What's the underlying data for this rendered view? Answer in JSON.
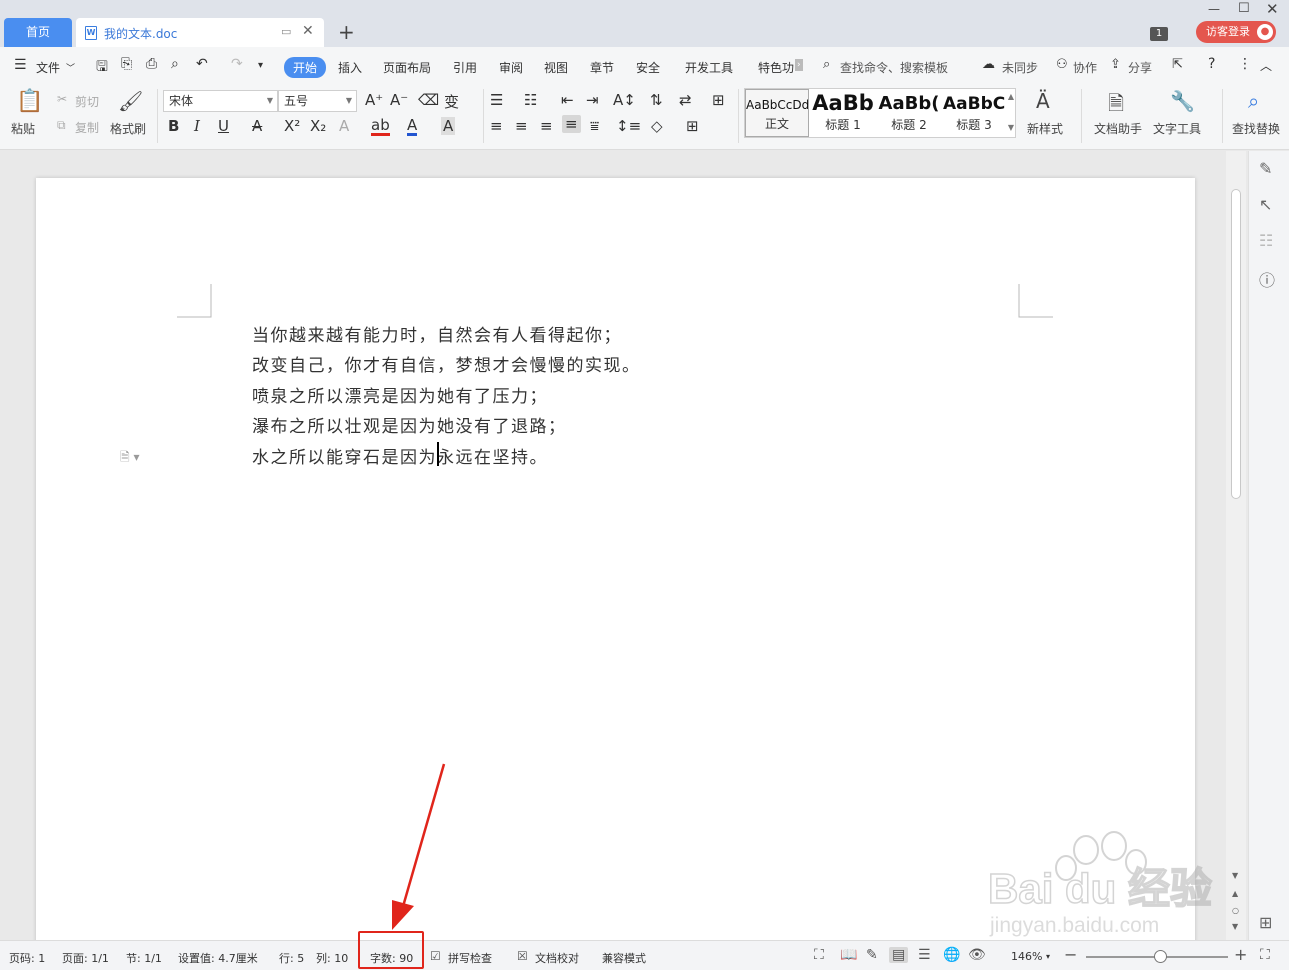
{
  "window": {
    "home_tab": "首页",
    "doc_tab": "我的文本.doc",
    "new_tab": "+",
    "tab_count": "1",
    "login": "访客登录"
  },
  "menu": {
    "file": "文件",
    "tabs": [
      "开始",
      "插入",
      "页面布局",
      "引用",
      "审阅",
      "视图",
      "章节",
      "安全",
      "开发工具",
      "特色功"
    ],
    "active_tab": "开始",
    "search": "查找命令、搜索模板",
    "sync": "未同步",
    "collab": "协作",
    "share": "分享"
  },
  "ribbon": {
    "paste": "粘贴",
    "cut": "剪切",
    "copy": "复制",
    "format_painter": "格式刷",
    "font_name": "宋体",
    "font_size": "五号",
    "styles": [
      {
        "preview": "AaBbCcDd",
        "name": "正文"
      },
      {
        "preview": "AaBb",
        "name": "标题 1"
      },
      {
        "preview": "AaBb(",
        "name": "标题 2"
      },
      {
        "preview": "AaBbC",
        "name": "标题 3"
      }
    ],
    "new_style": "新样式",
    "doc_assistant": "文档助手",
    "text_tools": "文字工具",
    "find_replace": "查找替换"
  },
  "document": {
    "lines": [
      "当你越来越有能力时，自然会有人看得起你；",
      "改变自己，你才有自信，梦想才会慢慢的实现。",
      "喷泉之所以漂亮是因为她有了压力；",
      "瀑布之所以壮观是因为她没有了退路；",
      "水之所以能穿石是因为永远在坚持。"
    ]
  },
  "status": {
    "page_num": "页码: 1",
    "page": "页面: 1/1",
    "section": "节: 1/1",
    "setting": "设置值: 4.7厘米",
    "row": "行: 5",
    "col": "列: 10",
    "word_count": "字数: 90",
    "spell_check": "拼写检查",
    "proofread": "文档校对",
    "compat_mode": "兼容模式",
    "zoom": "146%"
  },
  "watermark": {
    "brand": "Bai du 经验",
    "url": "jingyan.baidu.com"
  },
  "colors": {
    "accent": "#4a8ef0",
    "login": "#e4564e",
    "highlight": "#e0251b"
  }
}
